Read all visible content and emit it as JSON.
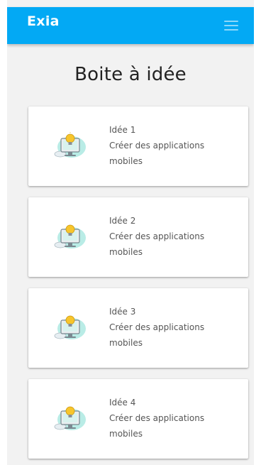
{
  "app": {
    "brand": "Exia",
    "menu_icon": "hamburger-menu-icon",
    "accent_color": "#03a9f4"
  },
  "page": {
    "title": "Boite à idée"
  },
  "ideas": [
    {
      "title": "Idée 1",
      "description": "Créer des applications mobiles",
      "icon": "lightbulb-computer-icon"
    },
    {
      "title": "Idée 2",
      "description": "Créer des applications mobiles",
      "icon": "lightbulb-computer-icon"
    },
    {
      "title": "Idée 3",
      "description": "Créer des applications mobiles",
      "icon": "lightbulb-computer-icon"
    },
    {
      "title": "Idée 4",
      "description": "Créer des applications mobiles",
      "icon": "lightbulb-computer-icon"
    }
  ]
}
